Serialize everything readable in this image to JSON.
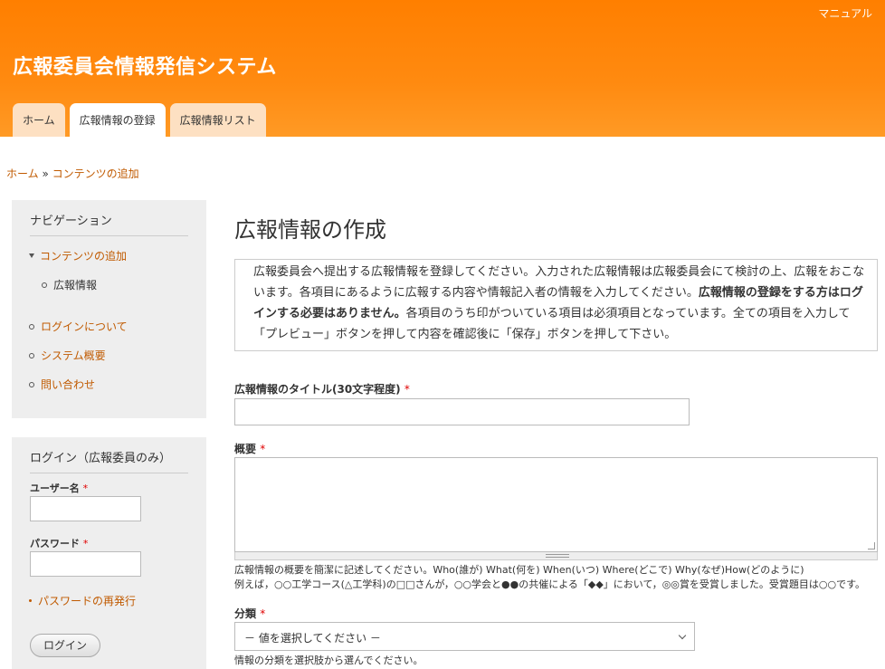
{
  "header": {
    "manual_link": "マニュアル",
    "site_title": "広報委員会情報発信システム",
    "tabs": [
      {
        "label": "ホーム"
      },
      {
        "label": "広報情報の登録"
      },
      {
        "label": "広報情報リスト"
      }
    ]
  },
  "breadcrumb": {
    "home": "ホーム",
    "separator": "»",
    "current": "コンテンツの追加"
  },
  "sidebar": {
    "navigation": {
      "title": "ナビゲーション",
      "items": [
        {
          "label": "コンテンツの追加"
        },
        {
          "label": "広報情報"
        },
        {
          "label": "ログインについて"
        },
        {
          "label": "システム概要"
        },
        {
          "label": "問い合わせ"
        }
      ]
    },
    "login": {
      "title": "ログイン（広報委員のみ）",
      "username_label": "ユーザー名",
      "password_label": "パスワード",
      "required_mark": "*",
      "reset_password_link": "パスワードの再発行",
      "login_button": "ログイン"
    }
  },
  "main": {
    "page_title": "広報情報の作成",
    "intro": {
      "part1": "広報委員会へ提出する広報情報を登録してください。入力された広報情報は広報委員会にて検討の上、広報をおこないます。各項目にあるように広報する内容や情報記入者の情報を入力してください。",
      "bold": "広報情報の登録をする方はログインする必要はありません。",
      "part2": "各項目のうち印がついている項目は必須項目となっています。全ての項目を入力して「プレビュー」ボタンを押して内容を確認後に「保存」ボタンを押して下さい。"
    },
    "form": {
      "required_mark": "*",
      "title_label": "広報情報のタイトル(30文字程度)",
      "summary_label": "概要",
      "summary_help1": "広報情報の概要を簡潔に記述してください。Who(誰が) What(何を) When(いつ) Where(どこで) Why(なぜ)How(どのように)",
      "summary_help2": "例えば，○○工学コース(△工学科)の□□さんが，○○学会と●●の共催による「◆◆」において，◎◎賞を受賞しました。受賞題目は○○です。",
      "category_label": "分類",
      "category_selected": "－ 値を選択してください －",
      "category_help": "情報の分類を選択肢から選んでください。"
    }
  },
  "colors": {
    "header_orange": "#ff8000",
    "tab_inactive": "#fde0c2",
    "link": "#c05a00",
    "required": "#e00000"
  }
}
